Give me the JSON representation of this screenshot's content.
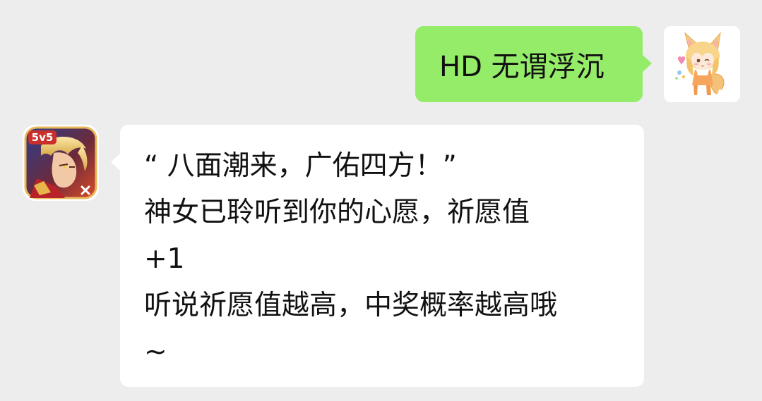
{
  "messages": {
    "outgoing": {
      "text": "HD 无谓浮沉",
      "bubble_color": "#95ec69",
      "avatar_icon": "fox-girl-avatar-icon"
    },
    "incoming": {
      "lines": [
        "“ 八面潮来，广佑四方！”",
        "神女已聆听到你的心愿，祈愿值",
        "+1",
        "听说祈愿值越高，中奖概率越高哦",
        "~"
      ],
      "bubble_color": "#ffffff",
      "avatar_icon": "game-app-5v5-icon",
      "avatar_badge": "5v5"
    }
  },
  "colors": {
    "background": "#ededed",
    "text": "#111111"
  }
}
